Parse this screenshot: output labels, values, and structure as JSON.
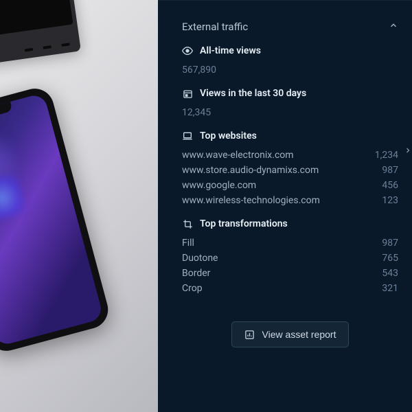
{
  "panel": {
    "title": "External traffic",
    "allTimeLabel": "All-time views",
    "allTimeValue": "567,890",
    "last30Label": "Views in the last 30 days",
    "last30Value": "12,345",
    "topWebsitesLabel": "Top websites",
    "websites": [
      {
        "name": "www.wave-electronix.com",
        "count": "1,234"
      },
      {
        "name": "www.store.audio-dynamixs.com",
        "count": "987"
      },
      {
        "name": "www.google.com",
        "count": "456"
      },
      {
        "name": "www.wireless-technologies.com",
        "count": "123"
      }
    ],
    "topTransformsLabel": "Top transformations",
    "transforms": [
      {
        "name": "Fill",
        "count": "987"
      },
      {
        "name": "Duotone",
        "count": "765"
      },
      {
        "name": "Border",
        "count": "543"
      },
      {
        "name": "Crop",
        "count": "321"
      }
    ],
    "reportButton": "View asset report"
  }
}
